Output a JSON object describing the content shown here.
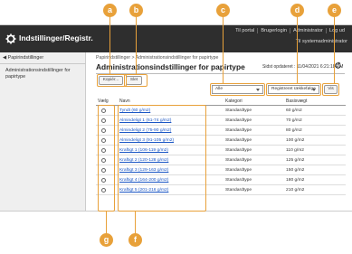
{
  "callouts": {
    "a": "a",
    "b": "b",
    "c": "c",
    "d": "d",
    "e": "e",
    "f": "f",
    "g": "g"
  },
  "header": {
    "title": "Indstillinger/Registr.",
    "links": [
      "Til portal",
      "Brugerlogin",
      "Administrator",
      "Log ud"
    ],
    "mode_link": "Til systemadministrator"
  },
  "sidebar": {
    "back_label": "◀ Papirindstillinger",
    "items": [
      {
        "label": "Administrationsindstillinger for papirtype"
      }
    ]
  },
  "main": {
    "breadcrumb": "Papirindstillinger > Administrationsindstillinger for papirtype",
    "title": "Administrationsindstillinger for papirtype",
    "updated": "Sidst opdateret : 11/04/2021 6:21:18 PM",
    "buttons": {
      "copy": "Kopiér...",
      "edit": "Slet"
    },
    "category_filter": "Alle",
    "sort_filter": "Registreret rækkefølge",
    "view_button": "Vis"
  },
  "table": {
    "headers": {
      "select": "Vælg",
      "name": "Navn",
      "category": "Kategori",
      "weight": "Basisvægt"
    },
    "rows": [
      {
        "name": "Tyndt (60 g/m2)",
        "category": "Standardtype",
        "weight": "60 g/m2"
      },
      {
        "name": "Almindeligt 1 (61-74 g/m2)",
        "category": "Standardtype",
        "weight": "70 g/m2"
      },
      {
        "name": "Almindeligt 2 (75-90 g/m2)",
        "category": "Standardtype",
        "weight": "80 g/m2"
      },
      {
        "name": "Almindeligt 3 (91-105 g/m2)",
        "category": "Standardtype",
        "weight": "100 g/m2"
      },
      {
        "name": "Kraftigt 1 (106-119 g/m2)",
        "category": "Standardtype",
        "weight": "110 g/m2"
      },
      {
        "name": "Kraftigt 2 (120-128 g/m2)",
        "category": "Standardtype",
        "weight": "125 g/m2"
      },
      {
        "name": "Kraftigt 3 (129-163 g/m2)",
        "category": "Standardtype",
        "weight": "150 g/m2"
      },
      {
        "name": "Kraftigt 4 (164-200 g/m2)",
        "category": "Standardtype",
        "weight": "180 g/m2"
      },
      {
        "name": "Kraftigt 5 (201-216 g/m2)",
        "category": "Standardtype",
        "weight": "210 g/m2"
      }
    ]
  },
  "colors": {
    "callout": "#e8a13a",
    "header_bg": "#2e2e2e",
    "link": "#1a56c4"
  }
}
